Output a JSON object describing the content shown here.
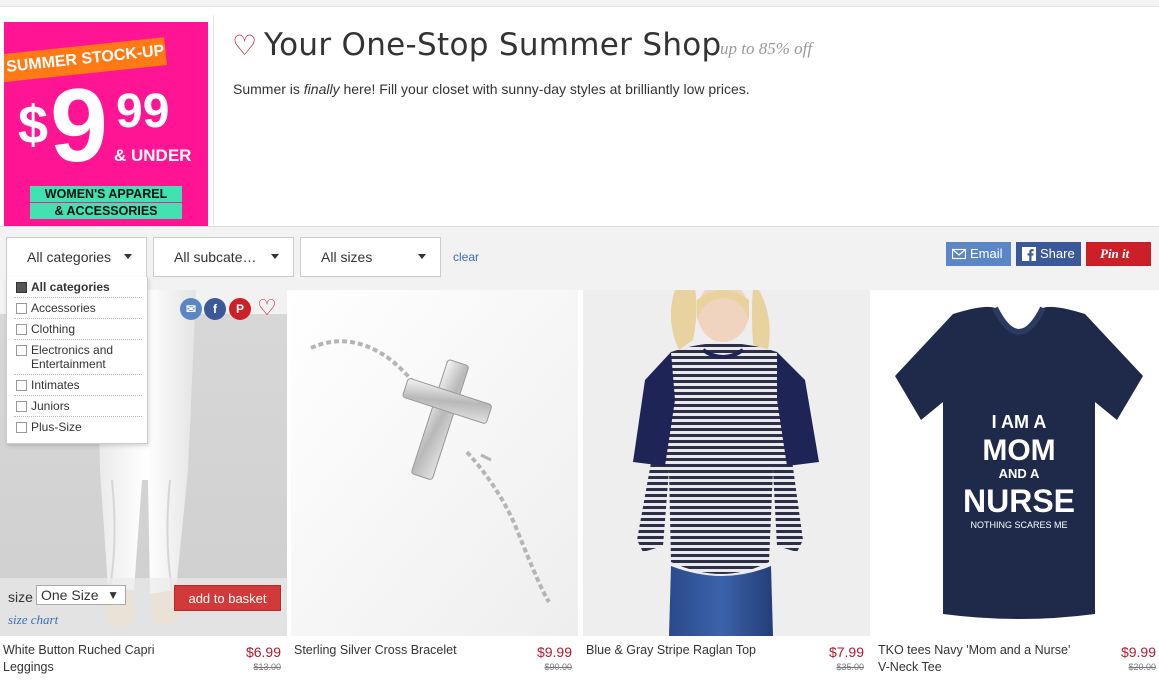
{
  "banner": {
    "promo": {
      "tag": "SUMMER STOCK-UP",
      "dollar": "$",
      "price_big": "9",
      "price_cents": "99",
      "under": "& UNDER",
      "line1": "WOMEN'S APPAREL",
      "line2": "& ACCESSORIES"
    },
    "title": "Your One-Stop Summer Shop",
    "discount": "up to 85% off",
    "desc_before": "Summer is ",
    "desc_em": "finally",
    "desc_after": " here! Fill your closet with sunny-day styles at brilliantly low prices."
  },
  "filters": {
    "category": "All categories",
    "subcategory": "All subcate…",
    "size": "All sizes",
    "clear": "clear",
    "category_options": [
      {
        "label": "All categories",
        "selected": true
      },
      {
        "label": "Accessories",
        "selected": false
      },
      {
        "label": "Clothing",
        "selected": false
      },
      {
        "label": "Electronics and Entertainment",
        "selected": false
      },
      {
        "label": "Intimates",
        "selected": false
      },
      {
        "label": "Juniors",
        "selected": false
      },
      {
        "label": "Plus-Size",
        "selected": false
      }
    ]
  },
  "share": {
    "email": "Email",
    "facebook": "Share",
    "pinterest": "Pin it"
  },
  "products": [
    {
      "name": "White Button Ruched Capri Leggings",
      "price": "$6.99",
      "was": "$13.00"
    },
    {
      "name": "Sterling Silver Cross Bracelet",
      "price": "$9.99",
      "was": "$90.00"
    },
    {
      "name": "Blue & Gray Stripe Raglan Top",
      "price": "$7.99",
      "was": "$35.00"
    },
    {
      "name": "TKO tees Navy 'Mom and a Nurse' V-Neck Tee",
      "price": "$9.99",
      "was": "$20.00"
    }
  ],
  "product_controls": {
    "size_label": "size",
    "size_value": "One Size",
    "add_label": "add to basket",
    "size_chart": "size chart"
  },
  "shirt_print": {
    "l1": "I AM A",
    "l2": "MOM",
    "l3": "AND A",
    "l4": "NURSE",
    "l5": "NOTHING SCARES ME"
  },
  "colors": {
    "promo_pink": "#ff1493",
    "accent_red": "#b2192e",
    "email_blue": "#5b86c5",
    "facebook_blue": "#3b5998",
    "pinterest_red": "#cb2027"
  }
}
